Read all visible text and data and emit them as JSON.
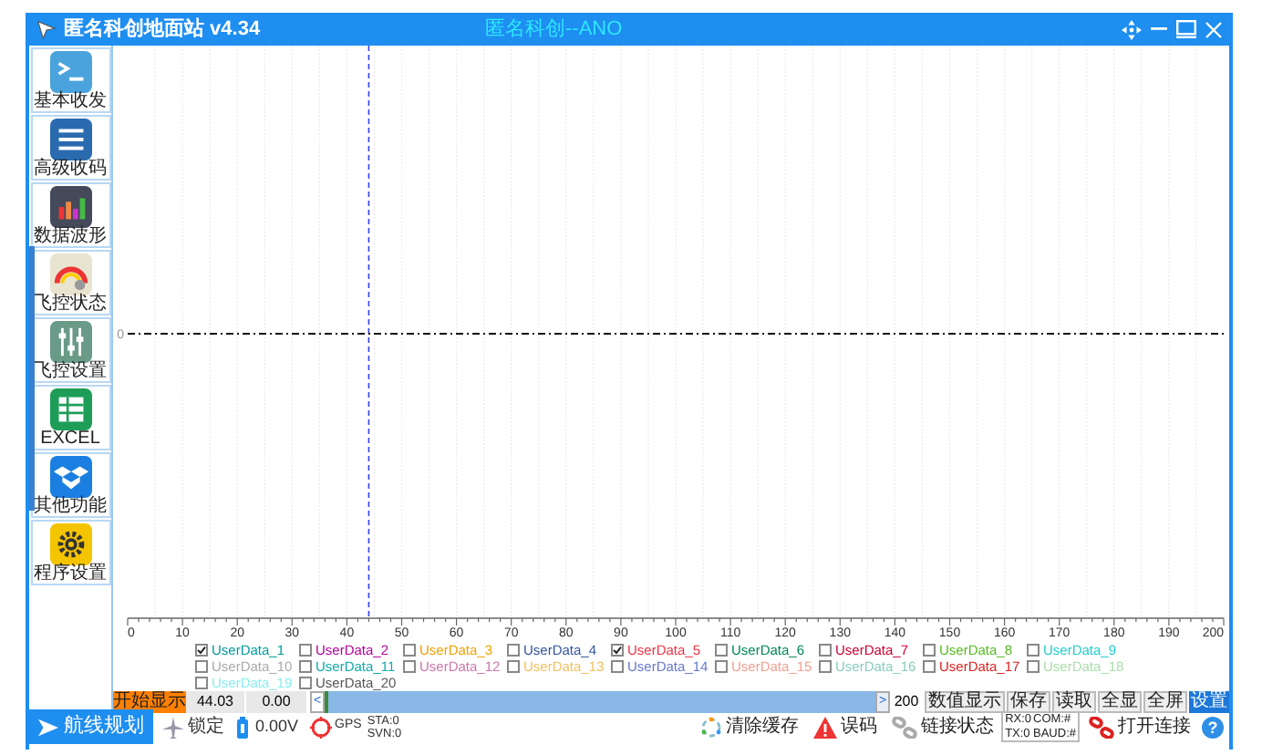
{
  "window": {
    "title": "匿名科创地面站 v4.34",
    "subtitle": "匿名科创--ANO"
  },
  "sidebar": {
    "items": [
      {
        "label": "基本收发",
        "kind": "terminal"
      },
      {
        "label": "高级收码",
        "kind": "list"
      },
      {
        "label": "数据波形",
        "kind": "bars"
      },
      {
        "label": "飞控状态",
        "kind": "gauge"
      },
      {
        "label": "飞控设置",
        "kind": "sliders"
      },
      {
        "label": "EXCEL",
        "kind": "sheet"
      },
      {
        "label": "其他功能",
        "kind": "box"
      },
      {
        "label": "程序设置",
        "kind": "gear"
      }
    ]
  },
  "chart": {
    "y_axis_label": "0",
    "x_axis_labels": [
      "0",
      "10",
      "20",
      "30",
      "40",
      "50",
      "60",
      "70",
      "80",
      "90",
      "100",
      "110",
      "120",
      "130",
      "140",
      "150",
      "160",
      "170",
      "180",
      "190",
      "200"
    ]
  },
  "legend": [
    {
      "label": "UserData_1",
      "checked": true,
      "color": "#009a9a"
    },
    {
      "label": "UserData_2",
      "checked": false,
      "color": "#b0009a"
    },
    {
      "label": "UserData_3",
      "checked": false,
      "color": "#f0a000"
    },
    {
      "label": "UserData_4",
      "checked": false,
      "color": "#33559a"
    },
    {
      "label": "UserData_5",
      "checked": true,
      "color": "#ee3344"
    },
    {
      "label": "UserData_6",
      "checked": false,
      "color": "#008855"
    },
    {
      "label": "UserData_7",
      "checked": false,
      "color": "#cc0033"
    },
    {
      "label": "UserData_8",
      "checked": false,
      "color": "#55bb22"
    },
    {
      "label": "UserData_9",
      "checked": false,
      "color": "#22cccc"
    },
    {
      "label": "UserData_10",
      "checked": false,
      "color": "#aaaaaa"
    },
    {
      "label": "UserData_11",
      "checked": false,
      "color": "#11aaaa"
    },
    {
      "label": "UserData_12",
      "checked": false,
      "color": "#cc77aa"
    },
    {
      "label": "UserData_13",
      "checked": false,
      "color": "#f0c060"
    },
    {
      "label": "UserData_14",
      "checked": false,
      "color": "#6677cc"
    },
    {
      "label": "UserData_15",
      "checked": false,
      "color": "#f0a090"
    },
    {
      "label": "UserData_16",
      "checked": false,
      "color": "#88ccbb"
    },
    {
      "label": "UserData_17",
      "checked": false,
      "color": "#dd2222"
    },
    {
      "label": "UserData_18",
      "checked": false,
      "color": "#aaddaa"
    },
    {
      "label": "UserData_19",
      "checked": false,
      "color": "#88eeee"
    },
    {
      "label": "UserData_20",
      "checked": false,
      "color": "#555555"
    }
  ],
  "controls": {
    "start_button": "开始显示",
    "value_1": "44.03",
    "value_2": "0.00",
    "scroll_left": "<",
    "scroll_right": ">",
    "count": "200",
    "buttons": [
      {
        "label": "数值显示",
        "selected": false
      },
      {
        "label": "保存",
        "selected": false
      },
      {
        "label": "读取",
        "selected": false
      },
      {
        "label": "全显",
        "selected": false
      },
      {
        "label": "全屏",
        "selected": false
      },
      {
        "label": "设置",
        "selected": true
      }
    ]
  },
  "status_bar": {
    "route_button": "航线规划",
    "lock": "锁定",
    "voltage": "0.00V",
    "gps": "GPS",
    "sta": "STA:0",
    "svn": "SVN:0",
    "clear_cache": "清除缓存",
    "error": "误码",
    "link_status": "链接状态",
    "rx": "RX:0",
    "com": "COM:#",
    "tx": "TX:0",
    "baud": "BAUD:#",
    "open_link": "打开连接",
    "help": "?"
  }
}
